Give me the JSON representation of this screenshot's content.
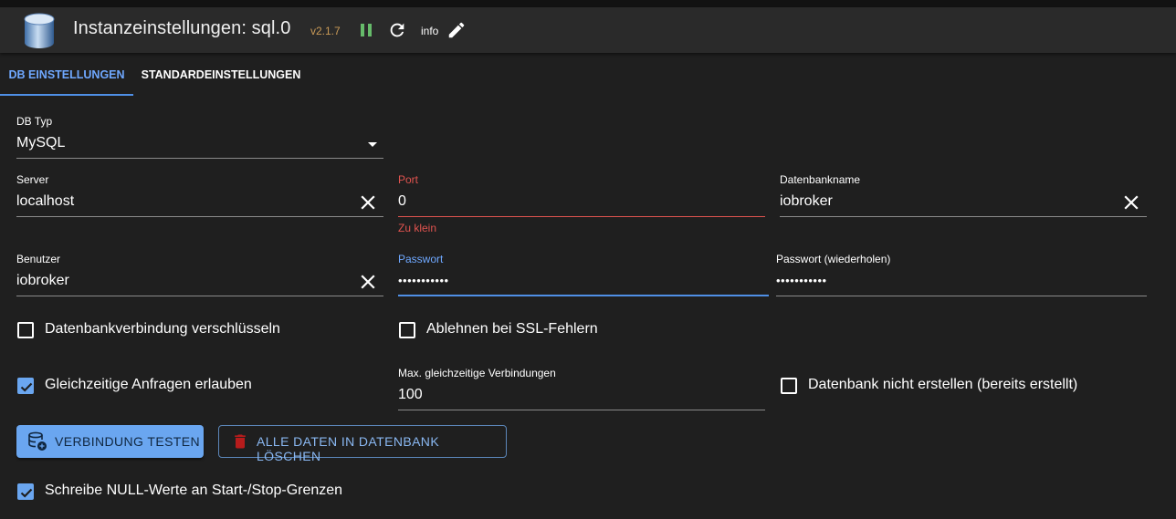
{
  "header": {
    "title": "Instanzeinstellungen: sql.0",
    "version": "v2.1.7",
    "loglevel": "info"
  },
  "tabs": [
    {
      "label": "DB Einstellungen",
      "active": true
    },
    {
      "label": "Standardeinstellungen",
      "active": false
    }
  ],
  "form": {
    "db_type": {
      "label": "DB Typ",
      "value": "MySQL"
    },
    "server": {
      "label": "Server",
      "value": "localhost"
    },
    "port": {
      "label": "Port",
      "value": "0",
      "error": "Zu klein"
    },
    "dbname": {
      "label": "Datenbankname",
      "value": "iobroker"
    },
    "user": {
      "label": "Benutzer",
      "value": "iobroker"
    },
    "password": {
      "label": "Passwort",
      "value": "•••••••••••"
    },
    "password_repeat": {
      "label": "Passwort (wiederholen)",
      "value": "•••••••••••"
    },
    "max_connections": {
      "label": "Max. gleichzeitige Verbindungen",
      "value": "100"
    }
  },
  "checkboxes": {
    "encrypt": {
      "label": "Datenbankverbindung verschlüsseln",
      "checked": false
    },
    "reject_ssl": {
      "label": "Ablehnen bei SSL-Fehlern",
      "checked": false
    },
    "parallel": {
      "label": "Gleichzeitige Anfragen erlauben",
      "checked": true
    },
    "no_create": {
      "label": "Datenbank nicht erstellen (bereits erstellt)",
      "checked": false
    },
    "write_nulls": {
      "label": "Schreibe NULL-Werte an Start-/Stop-Grenzen",
      "checked": true
    }
  },
  "buttons": {
    "test": "Verbindung testen",
    "delete_all": "Alle Daten in Datenbank löschen"
  },
  "colors": {
    "accent": "#6aa6f0",
    "error": "#e0534f",
    "version": "#c99a57",
    "pause": "#66bb6a",
    "delete_icon": "#b71c1c"
  },
  "icons": {
    "logo": "database-icon",
    "pause": "pause-icon",
    "reload": "reload-icon",
    "edit": "pencil-icon",
    "clear": "close-icon",
    "dropdown": "caret-down-icon",
    "test": "database-network-icon",
    "delete": "trash-icon"
  }
}
